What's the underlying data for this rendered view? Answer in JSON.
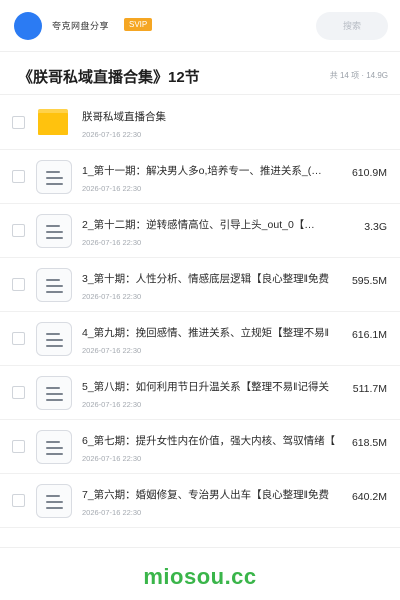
{
  "header": {
    "uploader_name": "夸克网盘分享",
    "badge": "SVIP",
    "search_placeholder": "搜索",
    "avatar_color": "#2b7bf3"
  },
  "share": {
    "title": "《朕哥私域直播合集》12节",
    "summary": "共 14 项 · 14.9G"
  },
  "items": [
    {
      "type": "folder",
      "icon": "folder-icon",
      "name": "朕哥私域直播合集",
      "date": "2026-07-16 22:30",
      "size": ""
    },
    {
      "type": "file",
      "icon": "document-icon",
      "name": "1_第十一期：解决男人多o,培养专一、推进关系_(…",
      "date": "2026-07-16 22:30",
      "size": "610.9M"
    },
    {
      "type": "file",
      "icon": "document-icon",
      "name": "2_第十二期：逆转感情高位、引导上头_out_0【…",
      "date": "2026-07-16 22:30",
      "size": "3.3G"
    },
    {
      "type": "file",
      "icon": "document-icon",
      "name": "3_第十期：人性分析、情感底层逻辑【良心整理‖免费",
      "date": "2026-07-16 22:30",
      "size": "595.5M"
    },
    {
      "type": "file",
      "icon": "document-icon",
      "name": "4_第九期：挽回感情、推进关系、立规矩【整理不易‖",
      "date": "2026-07-16 22:30",
      "size": "616.1M"
    },
    {
      "type": "file",
      "icon": "document-icon",
      "name": "5_第八期：如何利用节日升温关系【整理不易‖记得关",
      "date": "2026-07-16 22:30",
      "size": "511.7M"
    },
    {
      "type": "file",
      "icon": "document-icon",
      "name": "6_第七期：提升女性内在价值，强大内核、驾驭情绪【",
      "date": "2026-07-16 22:30",
      "size": "618.5M"
    },
    {
      "type": "file",
      "icon": "document-icon",
      "name": "7_第六期：婚姻修复、专治男人出车【良心整理‖免费",
      "date": "2026-07-16 22:30",
      "size": "640.2M"
    }
  ],
  "footer": {
    "brand": "miosou.cc",
    "brand_color": "#3ab54a"
  }
}
